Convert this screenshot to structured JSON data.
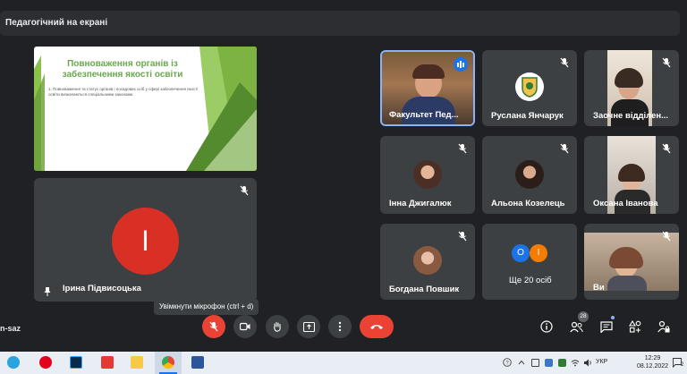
{
  "meeting": {
    "title": "Педагогічний на екрані",
    "code": "n-saz"
  },
  "slide": {
    "title": "Повноваження органів із забезпечення якості освіти",
    "body": "1. Повноваження та статус органів і посадових осіб у сфері забезпечення якості освіти визначаються спеціальними законами.",
    "accent": "#7cb342"
  },
  "presenter": {
    "initial": "І",
    "name": "Ірина Підвисоцька",
    "avatar_color": "#d93025"
  },
  "participants": [
    {
      "name": "Факультет Пед...",
      "active": true
    },
    {
      "name": "Руслана Янчарук",
      "muted": true
    },
    {
      "name": "Заочне відділен...",
      "muted": true
    },
    {
      "name": "Інна Джигалюк",
      "muted": true
    },
    {
      "name": "Альона Козелець",
      "muted": true
    },
    {
      "name": "Оксана Іванова",
      "muted": true
    },
    {
      "name": "Богдана Повшик",
      "muted": true
    },
    {
      "name": "Ще 20 осіб",
      "initials": [
        "О",
        "І"
      ]
    },
    {
      "name": "Ви",
      "muted": true
    }
  ],
  "tooltip": "Увімкнути мікрофон (ctrl + d)",
  "controls": {
    "people_count": "28"
  },
  "taskbar": {
    "time": "12:29",
    "date": "08.12.2022",
    "lang": "УКР",
    "notification_count": "2"
  }
}
